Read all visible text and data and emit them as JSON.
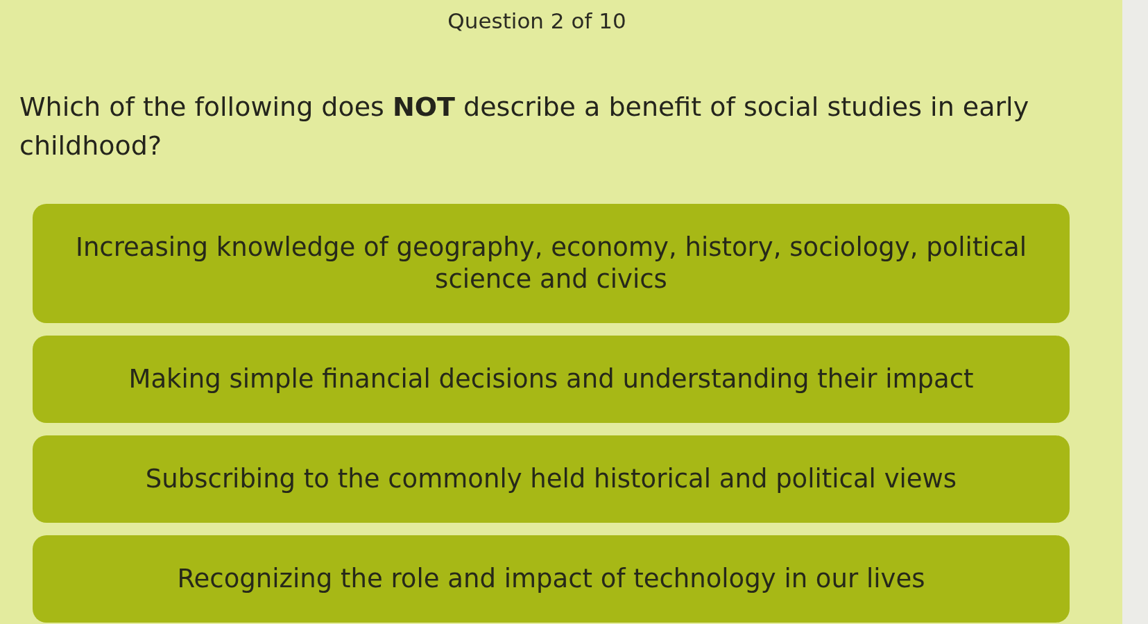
{
  "header": {
    "counter": "Question 2 of 10"
  },
  "question": {
    "text": "Which of the following does **NOT** describe a benefit of social studies in early childhood?"
  },
  "answers": [
    {
      "text": "Increasing knowledge of geography, economy, history, sociology, political science and civics",
      "selected": false
    },
    {
      "text": "Making simple financial decisions and understanding their impact",
      "selected": false
    },
    {
      "text": "Subscribing to the commonly held historical and political views",
      "selected": false
    },
    {
      "text": "Recognizing the role and impact of technology in our lives",
      "selected": false
    }
  ]
}
